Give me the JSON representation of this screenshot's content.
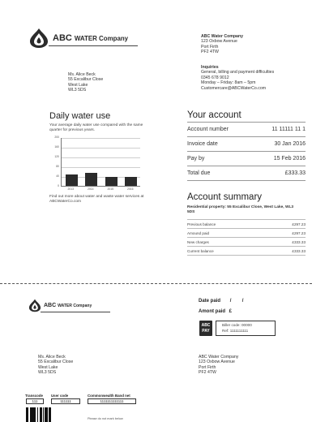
{
  "company": {
    "logo_text": "ABC",
    "logo_text_small": "WATER Company"
  },
  "sender_address": {
    "name": "ABC Water Company",
    "lines": [
      "123 Oxbow Avenue",
      "Port Firth",
      "PF2 4TW"
    ]
  },
  "inquiries": {
    "title": "Inquiries",
    "lines": [
      "General, billing and payment difficulties",
      "0345 678 9012",
      "Monday – Friday: 8am – 5pm",
      "Customercare@ABCWaterCo.com"
    ]
  },
  "recipient": {
    "lines": [
      "Ms. Alice Beck",
      "55 Excalibur Close",
      "West Lake",
      "WL3 5DS"
    ]
  },
  "usage": {
    "title": "Daily water use",
    "description": "Your average daily water use compared with the same quarter for previous years.",
    "footer": "Find out more about water and waste water services at ABCWaterCo.com"
  },
  "chart_data": {
    "type": "bar",
    "categories": [
      "2013",
      "2014",
      "2015",
      "2016"
    ],
    "values": [
      48,
      52,
      36,
      38
    ],
    "y_ticks": [
      "200",
      "160",
      "120",
      "80",
      "40",
      "0"
    ],
    "ylim": [
      0,
      200
    ],
    "grid": true,
    "bar_color": "#2b2b2b"
  },
  "account": {
    "title": "Your account",
    "rows": [
      {
        "label": "Account number",
        "value": "11 11111 11 1"
      },
      {
        "label": "Invoice date",
        "value": "30 Jan 2016"
      },
      {
        "label": "Pay by",
        "value": "15 Feb 2016"
      },
      {
        "label": "Total due",
        "value": "£333.33"
      }
    ]
  },
  "summary": {
    "title": "Account summary",
    "property": "Residential property: 55 Excalibur Close, West Lake, WL3 5DS",
    "rows": [
      {
        "label": "Previous balance",
        "value": "£297.23"
      },
      {
        "label": "Amound paid",
        "value": "£297.23"
      },
      {
        "label": "New charges",
        "value": "£333.33"
      },
      {
        "label": "Current balance",
        "value": "£333.33"
      }
    ]
  },
  "slip": {
    "date_paid_label": "Date paid",
    "date_sep": "/        /",
    "amount_paid_label": "Amont paid",
    "currency": "£",
    "abc_pay_line1": "ABC",
    "abc_pay_line2": "PAY",
    "biller_code": "Biller code: 00000",
    "ref": "Ref: 1111111111",
    "transcode_label": "Transcode",
    "transcode_value": "111",
    "usercode_label": "User code",
    "usercode_value": "111111",
    "band_label": "Commonwealth Band net",
    "band_value": "1111111111111",
    "no_mark": "Please do not mark below"
  },
  "colors": {
    "accent": "#2b2b2b",
    "rule": "#999999"
  }
}
